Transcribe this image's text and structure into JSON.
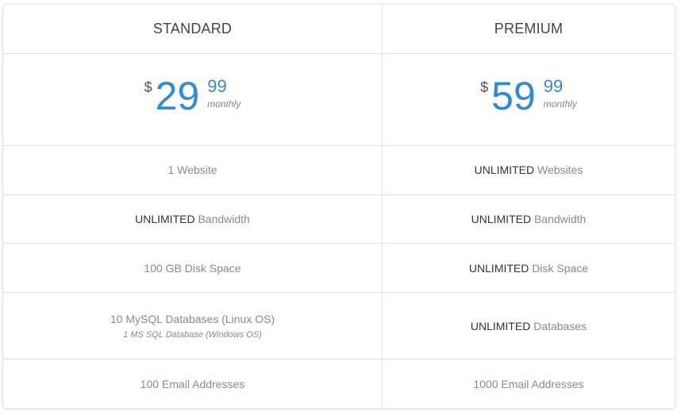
{
  "plans": [
    {
      "name": "STANDARD",
      "price": {
        "currency": "$",
        "amount": "29",
        "cents": "99",
        "period": "monthly"
      },
      "features": [
        {
          "strong": "",
          "text": "1 Website",
          "sub": ""
        },
        {
          "strong": "UNLIMITED",
          "text": " Bandwidth",
          "sub": ""
        },
        {
          "strong": "",
          "text": "100 GB Disk Space",
          "sub": ""
        },
        {
          "strong": "",
          "text": "10 MySQL Databases (Linux OS)",
          "sub": "1 MS SQL Database (Windows OS)"
        },
        {
          "strong": "",
          "text": "100 Email Addresses",
          "sub": ""
        }
      ]
    },
    {
      "name": "PREMIUM",
      "price": {
        "currency": "$",
        "amount": "59",
        "cents": "99",
        "period": "monthly"
      },
      "features": [
        {
          "strong": "UNLIMITED",
          "text": " Websites",
          "sub": ""
        },
        {
          "strong": "UNLIMITED",
          "text": " Bandwidth",
          "sub": ""
        },
        {
          "strong": "UNLIMITED",
          "text": " Disk Space",
          "sub": ""
        },
        {
          "strong": "UNLIMITED",
          "text": " Databases",
          "sub": ""
        },
        {
          "strong": "",
          "text": "1000 Email Addresses",
          "sub": ""
        }
      ]
    }
  ],
  "colors": {
    "accent": "#2e8bd8",
    "border": "#e3e3e3",
    "muted_text": "#8a8a8a",
    "strong_text": "#333333"
  }
}
